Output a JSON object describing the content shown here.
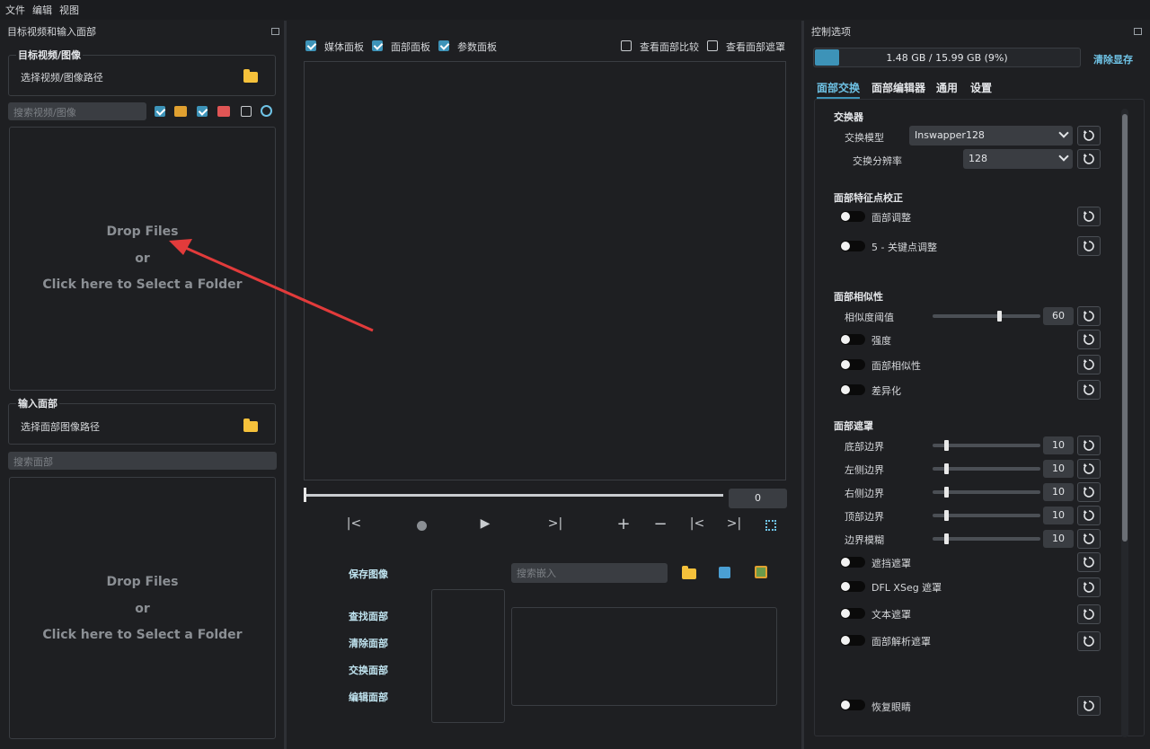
{
  "menu": {
    "file": "文件",
    "edit": "编辑",
    "view": "视图"
  },
  "left_dock": {
    "title": "目标视频和输入面部",
    "target_group_title": "目标视频/图像",
    "target_path_label": "选择视频/图像路径",
    "target_search_placeholder": "搜索视频/图像",
    "target_filters": {
      "images": true,
      "videos": true,
      "webcam": false
    },
    "drop_line1": "Drop Files",
    "drop_line2": "or",
    "drop_line3": "Click here to Select a Folder",
    "input_group_title": "输入面部",
    "input_path_label": "选择面部图像路径",
    "input_search_placeholder": "搜索面部"
  },
  "center": {
    "media_panel": "媒体面板",
    "face_panel": "面部面板",
    "param_panel": "参数面板",
    "media_panel_checked": true,
    "face_panel_checked": true,
    "param_panel_checked": true,
    "view_face_compare": "查看面部比较",
    "view_face_mask": "查看面部遮罩",
    "frame_value": "0",
    "save_image": "保存图像",
    "embed_search_placeholder": "搜索嵌入",
    "find_faces": "查找面部",
    "clear_faces": "清除面部",
    "swap_faces": "交换面部",
    "edit_faces": "编辑面部"
  },
  "right_dock": {
    "title": "控制选项",
    "memory_text": "1.48 GB / 15.99 GB (9%)",
    "memory_fraction": 0.09,
    "clear_vram": "清除显存",
    "tabs": [
      "面部交换",
      "面部编辑器",
      "通用",
      "设置"
    ],
    "active_tab": 0,
    "swapper_title": "交换器",
    "swap_model_label": "交换模型",
    "swap_model_value": "Inswapper128",
    "swap_res_label": "交换分辨率",
    "swap_res_value": "128",
    "landmark_title": "面部特征点校正",
    "face_adjust": "面部调整",
    "keypoint_adjust": "5 - 关键点调整",
    "similarity_title": "面部相似性",
    "similarity_threshold_label": "相似度阈值",
    "similarity_threshold_value": "60",
    "similarity_threshold_fraction": 0.6,
    "strength": "强度",
    "face_similarity": "面部相似性",
    "differencing": "差异化",
    "mask_title": "面部遮罩",
    "bottom_border": "底部边界",
    "left_border": "左侧边界",
    "right_border": "右侧边界",
    "top_border": "顶部边界",
    "border_blur": "边界模糊",
    "border_value": "10",
    "occlusion_mask": "遮挡遮罩",
    "dfl_xseg_mask": "DFL XSeg 遮罩",
    "text_mask": "文本遮罩",
    "face_parse_mask": "面部解析遮罩",
    "restore_eyes": "恢复眼睛"
  }
}
